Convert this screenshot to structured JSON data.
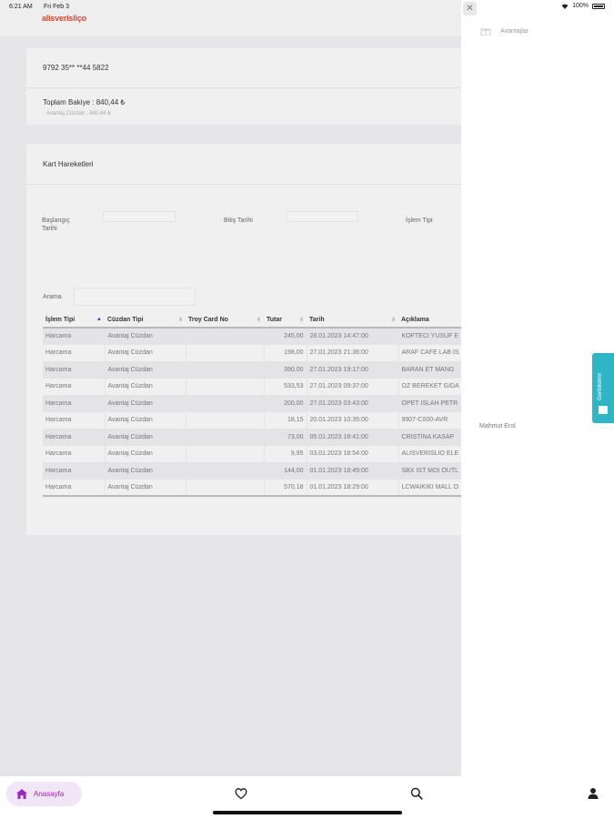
{
  "status_bar": {
    "time": "6:21 AM",
    "date": "Fri Feb 3",
    "battery": "100%"
  },
  "header": {
    "logo_text": "alisverisliço"
  },
  "card_info": {
    "card_number": "9792 35** **44 5822",
    "total_balance": "Toplam Bakiye : 840,44 ₺",
    "wallet_balance": "Avantaj Cüzdan : 840,44 ₺"
  },
  "transactions": {
    "title": "Kart Hareketleri",
    "filters": {
      "start_date_label_line1": "Başlangıç",
      "start_date_label_line2": "Tarihi",
      "end_date_label": "Bitiş Tarihi",
      "type_label": "İşlem Tipi",
      "search_label": "Arama"
    },
    "columns": [
      "İşlem Tipi",
      "Cüzdan Tipi",
      "Troy Card No",
      "Tutar",
      "Tarih",
      "Açıklama"
    ],
    "rows": [
      [
        "Harcama",
        "Avantaj Cüzdan",
        "",
        "245,00",
        "28.01.2023 14:47:00",
        "KOFTECI YUSUF E"
      ],
      [
        "Harcama",
        "Avantaj Cüzdan",
        "",
        "198,00",
        "27.01.2023 21:36:00",
        "ARAF CAFE LAB IS"
      ],
      [
        "Harcama",
        "Avantaj Cüzdan",
        "",
        "390,00",
        "27.01.2023 19:17:00",
        "BARAN ET MANG"
      ],
      [
        "Harcama",
        "Avantaj Cüzdan",
        "",
        "533,53",
        "27.01.2023 09:37:00",
        "OZ BEREKET GIDA"
      ],
      [
        "Harcama",
        "Avantaj Cüzdan",
        "",
        "200,00",
        "27.01.2023 03:43:00",
        "OPET ISLAH PETR"
      ],
      [
        "Harcama",
        "Avantaj Cüzdan",
        "",
        "18,15",
        "20.01.2023 10:35:00",
        "9907-C000-AVR"
      ],
      [
        "Harcama",
        "Avantaj Cüzdan",
        "",
        "73,00",
        "05.01.2023 18:41:00",
        "CRISTINA KASAP"
      ],
      [
        "Harcama",
        "Avantaj Cüzdan",
        "",
        "9,95",
        "03.01.2023 18:54:00",
        "ALISVERISLIO ELE"
      ],
      [
        "Harcama",
        "Avantaj Cüzdan",
        "",
        "144,00",
        "01.01.2023 18:49:00",
        "SBX IST MOI OUTL"
      ],
      [
        "Harcama",
        "Avantaj Cüzdan",
        "",
        "570,18",
        "01.01.2023 18:29:00",
        "LCWAIKIKI MALL O"
      ]
    ]
  },
  "side_panel": {
    "close_glyph": "✕",
    "menu_item": "Avantajlar",
    "user_name": "Mahmut Erol"
  },
  "feedback_tab": {
    "label": "Geribildirim",
    "color": "#2fb6c6"
  },
  "bottom_nav": {
    "home_label": "Anasayfa",
    "accent": "#9a25c0"
  }
}
